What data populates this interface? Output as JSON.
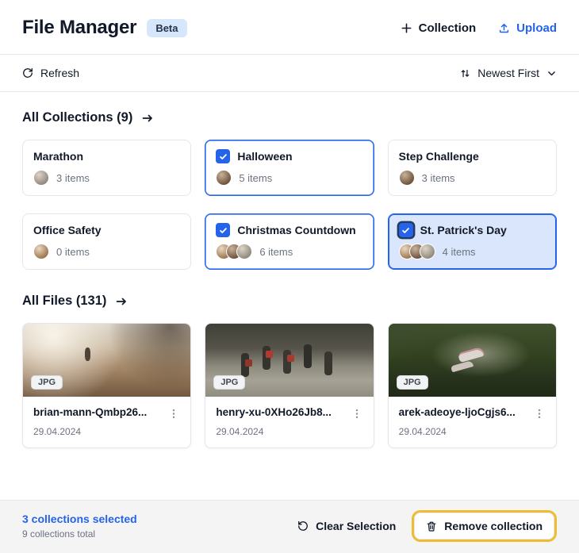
{
  "header": {
    "title": "File Manager",
    "beta_badge": "Beta",
    "collection_button": "Collection",
    "upload_button": "Upload"
  },
  "toolbar": {
    "refresh_label": "Refresh",
    "sort_label": "Newest First"
  },
  "collections_section": {
    "title": "All Collections (9)",
    "cards": [
      {
        "name": "Marathon",
        "items": "3 items",
        "selected": false
      },
      {
        "name": "Halloween",
        "items": "5 items",
        "selected": true
      },
      {
        "name": "Step Challenge",
        "items": "3 items",
        "selected": false
      },
      {
        "name": "Office Safety",
        "items": "0 items",
        "selected": false
      },
      {
        "name": "Christmas Countdown",
        "items": "6 items",
        "selected": true
      },
      {
        "name": "St. Patrick's Day",
        "items": "4 items",
        "selected": true,
        "highlighted": true
      }
    ]
  },
  "files_section": {
    "title": "All Files (131)",
    "files": [
      {
        "name": "brian-mann-Qmbp26...",
        "type": "JPG",
        "date": "29.04.2024"
      },
      {
        "name": "henry-xu-0XHo26Jb8...",
        "type": "JPG",
        "date": "29.04.2024"
      },
      {
        "name": "arek-adeoye-ljoCgjs6...",
        "type": "JPG",
        "date": "29.04.2024"
      }
    ]
  },
  "footer": {
    "selected_text": "3 collections selected",
    "total_text": "9 collections total",
    "clear_button": "Clear Selection",
    "remove_button": "Remove collection"
  },
  "icons": {
    "plus": "+",
    "upload": "↥",
    "refresh": "⟳",
    "sort": "⇅",
    "chevron_down": "⌄",
    "arrow_right": "→",
    "check": "✓",
    "kebab": "⋮",
    "clear": "↺",
    "trash": "🗑"
  },
  "colors": {
    "accent_blue": "#2563eb",
    "selected_card_bg": "#d9e6fb",
    "highlight_yellow": "#eebb31",
    "footer_bg": "#f4f4f5"
  }
}
